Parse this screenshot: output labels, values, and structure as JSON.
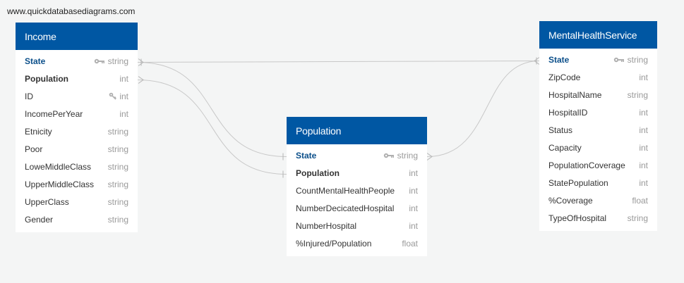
{
  "watermark": "www.quickdatabasediagrams.com",
  "tables": {
    "income": {
      "title": "Income",
      "fields": [
        {
          "name": "State",
          "type": "string",
          "icon": "key-icon"
        },
        {
          "name": "Population",
          "type": "int"
        },
        {
          "name": "ID",
          "type": "int",
          "icon": "key-icon"
        },
        {
          "name": "IncomePerYear",
          "type": "int"
        },
        {
          "name": "Etnicity",
          "type": "string"
        },
        {
          "name": "Poor",
          "type": "string"
        },
        {
          "name": "LoweMiddleClass",
          "type": "string"
        },
        {
          "name": "UpperMiddleClass",
          "type": "string"
        },
        {
          "name": "UpperClass",
          "type": "string"
        },
        {
          "name": "Gender",
          "type": "string"
        }
      ]
    },
    "population": {
      "title": "Population",
      "fields": [
        {
          "name": "State",
          "type": "string",
          "icon": "key-icon"
        },
        {
          "name": "Population",
          "type": "int"
        },
        {
          "name": "CountMentalHealthPeople",
          "type": "int"
        },
        {
          "name": "NumberDecicatedHospital",
          "type": "int"
        },
        {
          "name": "NumberHospital",
          "type": "int"
        },
        {
          "name": "%Injured/Population",
          "type": "float"
        }
      ]
    },
    "mental": {
      "title": "MentalHealthService",
      "fields": [
        {
          "name": "State",
          "type": "string",
          "icon": "key-icon"
        },
        {
          "name": "ZipCode",
          "type": "int"
        },
        {
          "name": "HospitalName",
          "type": "string"
        },
        {
          "name": "HospitalID",
          "type": "int"
        },
        {
          "name": "Status",
          "type": "int"
        },
        {
          "name": "Capacity",
          "type": "int"
        },
        {
          "name": "PopulationCoverage",
          "type": "int"
        },
        {
          "name": "StatePopulation",
          "type": "int"
        },
        {
          "name": "%Coverage",
          "type": "float"
        },
        {
          "name": "TypeOfHospital",
          "type": "string"
        }
      ]
    }
  },
  "colors": {
    "header": "#0057a3",
    "link": "#c8c8c8",
    "pk_text": "#0b4f8a"
  }
}
